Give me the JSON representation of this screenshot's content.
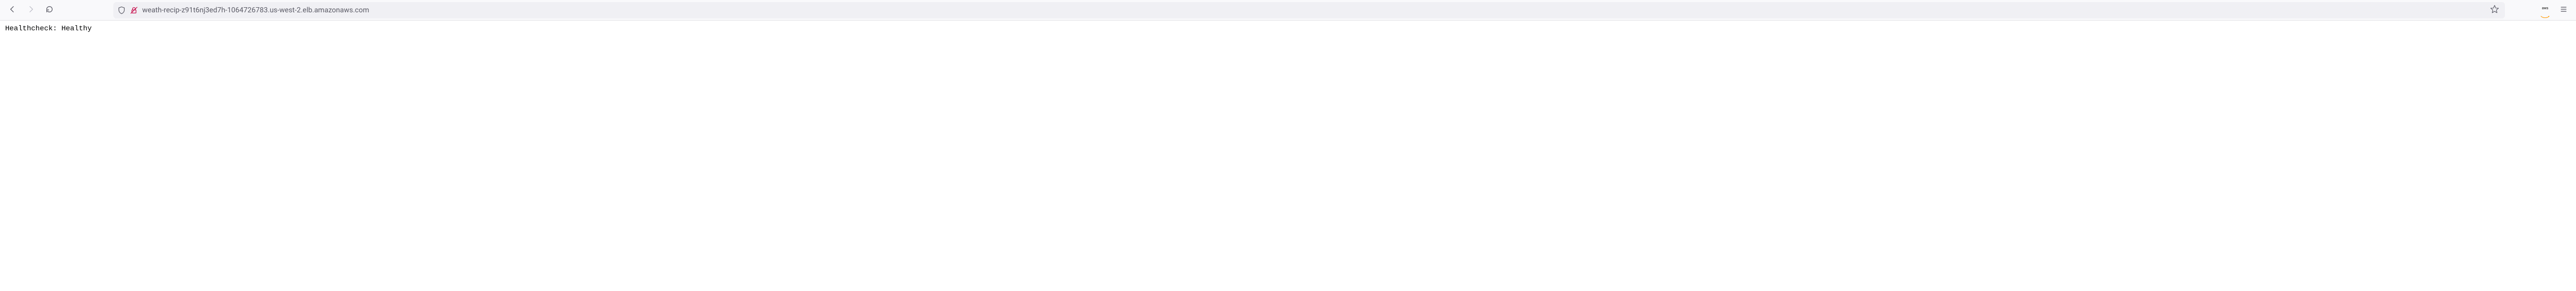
{
  "toolbar": {
    "url": "weath-recip-z91t6nj3ed7h-1064726783.us-west-2.elb.amazonaws.com",
    "extension_label": "aws"
  },
  "page": {
    "body_text": "Healthcheck: Healthy"
  }
}
